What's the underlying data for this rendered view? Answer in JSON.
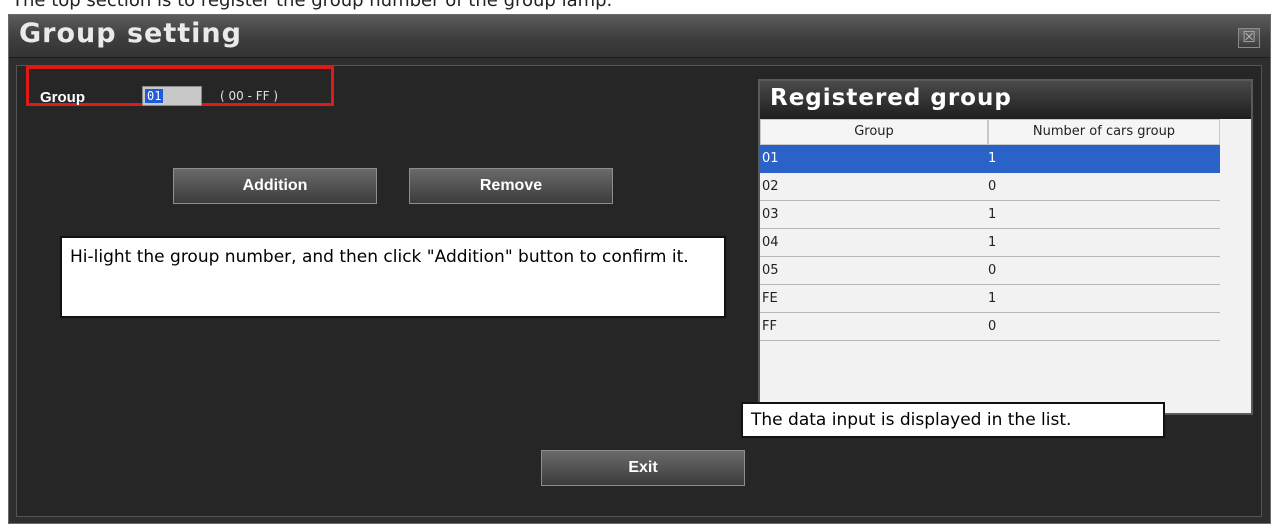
{
  "top_caption": "The top section is to register the group number of the group lamp.",
  "window": {
    "title": "Group setting",
    "close_glyph": "☒"
  },
  "form": {
    "group_label": "Group",
    "group_value": "01",
    "range_hint": "( 00 - FF )"
  },
  "buttons": {
    "addition": "Addition",
    "remove": "Remove",
    "exit": "Exit"
  },
  "notes": {
    "left": "Hi-light the group number, and then click \"Addition\" button to confirm it.",
    "right": "The data input is displayed in the list."
  },
  "registered_group": {
    "title": "Registered group",
    "columns": [
      "Group",
      "Number of cars group"
    ],
    "rows": [
      {
        "group": "01",
        "cars": "1",
        "selected": true
      },
      {
        "group": "02",
        "cars": "0"
      },
      {
        "group": "03",
        "cars": "1"
      },
      {
        "group": "04",
        "cars": "1"
      },
      {
        "group": "05",
        "cars": "0"
      },
      {
        "group": "FE",
        "cars": "1"
      },
      {
        "group": "FF",
        "cars": "0"
      }
    ]
  },
  "colors": {
    "accent_highlight": "#e01818",
    "selection": "#2a62c8",
    "window_bg": "#262626"
  }
}
